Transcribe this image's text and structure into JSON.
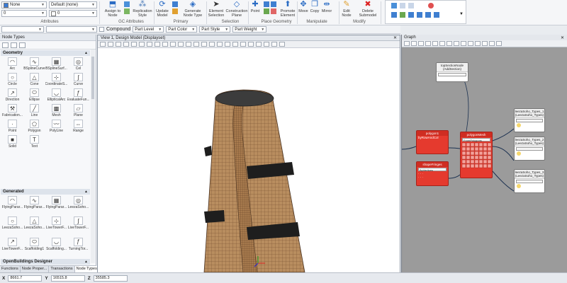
{
  "ribbon": {
    "attributes": {
      "level": "None",
      "style": "Default (none)",
      "weight": "0",
      "color": "0",
      "group_label": "Attributes"
    },
    "groups": [
      {
        "label": "GC Attributes"
      },
      {
        "label": "Primary"
      },
      {
        "label": "Selection"
      },
      {
        "label": "Place Geometry"
      },
      {
        "label": "Manipulate"
      },
      {
        "label": "Modify"
      }
    ],
    "buttons": {
      "assign_to_node": "Assign to Node",
      "replication_style": "Replication Style",
      "update_model": "Update Model",
      "generate_node_type": "Generate Node Type",
      "element_selection": "Element Selection",
      "construction_plane": "Construction Plane",
      "point": "Point",
      "promote_element": "Promote Element",
      "move": "Move",
      "copy": "Copy",
      "mirror": "Mirror",
      "edit_node": "Edit Node",
      "delete_submodel": "Delete Submodel"
    }
  },
  "toolbar2": {
    "compound": "Compound",
    "part_level": "Part Level",
    "part_color": "Part Color",
    "part_style": "Part Style",
    "part_weight": "Part Weight"
  },
  "node_panel": {
    "title": "Node Types",
    "sections": {
      "geometry": "Geometry",
      "generated": "Generated",
      "openbuildings": "OpenBuildings Designer"
    },
    "geometry_nodes": [
      "Arc",
      "BSplineCurve",
      "BSplineSurf...",
      "Cel",
      "Circle",
      "Cone",
      "CoordinateS...",
      "Curve",
      "Direction",
      "Ellipse",
      "EllipticalArc",
      "EvaluateFun...",
      "Fabrication...",
      "Line",
      "Mesh",
      "Plane",
      "Point",
      "Polygon",
      "PolyLine",
      "Range",
      "Solid",
      "Text"
    ],
    "generated_nodes": [
      "FlyingParar...",
      "FlyingParar...",
      "FlyingParar...",
      "LeezaSoho...",
      "LeezaSoho...",
      "LeezaSoho...",
      "LiveTowerF...",
      "LiveTowerF...",
      "LiveTowerF...",
      "Scaffolding1",
      "Scaffolding...",
      "TurningTor..."
    ],
    "ob_nodes": [
      "Building",
      "BuildingCo...",
      "Compound...",
      "Door"
    ],
    "tabs": [
      "Functions",
      "Node Proper...",
      "Transactions",
      "Node Types"
    ]
  },
  "view": {
    "title": "View 1, Design Model (Displayset)"
  },
  "graph": {
    "title": "Graph",
    "nodes": {
      "top": {
        "title": "topSectionNode",
        "subtitle": "(AddSection)"
      },
      "red1": {
        "title": "polygon1",
        "field": "byRowAndCol"
      },
      "red2": {
        "title": "shapeFringes",
        "field": "ByVertices"
      },
      "red3": {
        "title": "polygonMesh",
        "field": "FromPolygons"
      },
      "w1": {
        "title": "leezaSoho_Types_1",
        "subtitle": "(LeezaSoho_Types)"
      },
      "w2": {
        "title": "leezaSoho_Types_2",
        "subtitle": "(LeezaSoho_Types)"
      },
      "w3": {
        "title": "leezaSoho_Types_3",
        "subtitle": "(LeezaSoho_Types)"
      }
    }
  },
  "status": {
    "x_label": "X",
    "x_value": "8661.7",
    "y_label": "Y",
    "y_value": "16515.8",
    "z_label": "Z",
    "z_value": "35585.3"
  },
  "colors": {
    "tower_mesh": "#b88d5f",
    "tower_mesh_dark": "#7a5534",
    "graph_bg": "#9b9b9b",
    "node_red": "#e53a2e"
  }
}
